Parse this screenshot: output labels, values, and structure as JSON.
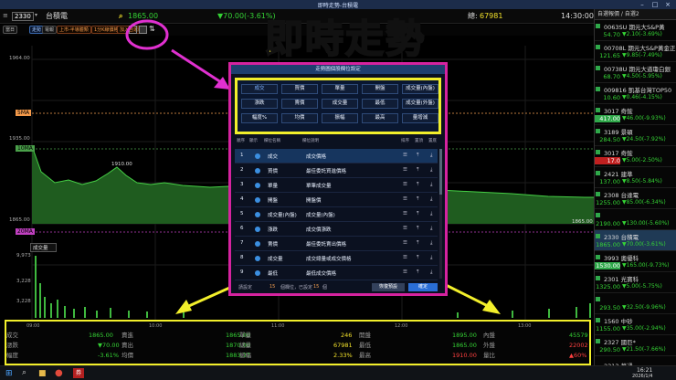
{
  "window": {
    "title": "即時走勢-台積電"
  },
  "header": {
    "code": "2330",
    "name": "台積電",
    "price_partial": "1865.00",
    "change_partial": "▼70.00(-3.61%)",
    "volume_label": "總:",
    "volume": "67981",
    "time": "14:30:00"
  },
  "toolbar": {
    "period": "當日",
    "tab_trend": "走勢",
    "tab_tick": "電報",
    "chips": [
      "上市-半導體類",
      "1分K線價格",
      "加入自選股"
    ]
  },
  "overlay_title": "即時走勢",
  "chart": {
    "y_labels": [
      "1964.00",
      "1935.00",
      "1865.00"
    ],
    "tags": {
      "ma5": "5MA",
      "ma10": "10MA",
      "ma20": "20MA"
    },
    "peak_label": "1910.00",
    "low_label": "1865.00",
    "volume_box": "成交量",
    "vol_labels": [
      "9,973",
      "3,228",
      "3,228"
    ],
    "time_ticks": [
      "09:00",
      "10:00",
      "11:00",
      "12:00",
      "13:00"
    ]
  },
  "bottom_table": [
    {
      "label": "成交",
      "value": "1865.00",
      "label2": "賣進",
      "value2": "1865.00",
      "label3": "單量",
      "value3": "246",
      "label4": "開盤",
      "value4": "1895.00",
      "label5": "內盤",
      "value5": "45579"
    },
    {
      "label": "漲跌",
      "value": "▼70.00",
      "label2": "賣出",
      "value2": "1870.00",
      "label3": "總量",
      "value3": "67981",
      "label4": "最低",
      "value4": "1865.00",
      "label5": "外盤",
      "value5": "22002"
    },
    {
      "label": "幅度",
      "value": "-3.61%",
      "label2": "均價",
      "value2": "1883.37",
      "label3": "振幅",
      "value3": "2.33%",
      "label4": "最高",
      "value4": "1910.00",
      "label5": "量比",
      "value5": "▲60%"
    }
  ],
  "dialog": {
    "title": "走勢圖個股欄位設定",
    "buttons": [
      "成交",
      "買價",
      "單量",
      "開盤",
      "成交量(內盤)",
      "漲跌",
      "賣價",
      "成交量",
      "最低",
      "成交量(外盤)",
      "幅度%",
      "均價",
      "振幅",
      "最高",
      "量增減"
    ],
    "columns": [
      "順序",
      "顯示",
      "欄位名稱",
      "欄位說明",
      "排序",
      "置頂",
      "置底"
    ],
    "rows": [
      {
        "no": "1",
        "field": "成交",
        "desc": "成交價格"
      },
      {
        "no": "2",
        "field": "買價",
        "desc": "最佳委託買進價格"
      },
      {
        "no": "3",
        "field": "單量",
        "desc": "單筆成交量"
      },
      {
        "no": "4",
        "field": "開盤",
        "desc": "開盤價"
      },
      {
        "no": "5",
        "field": "成交量(內盤)",
        "desc": "成交量(內盤)"
      },
      {
        "no": "6",
        "field": "漲跌",
        "desc": "成交價漲跌"
      },
      {
        "no": "7",
        "field": "賣價",
        "desc": "最佳委託賣出價格"
      },
      {
        "no": "8",
        "field": "成交量",
        "desc": "成交總量或成交價格"
      },
      {
        "no": "9",
        "field": "最低",
        "desc": "最低成交價格"
      }
    ],
    "footer_label": "請設定",
    "footer_count": "15",
    "footer_mid": "個欄位，已設定",
    "footer_count2": "15",
    "footer_unit": "個",
    "reset_btn": "恢復預設",
    "ok_btn": "確定"
  },
  "rpanel": {
    "header": "自選報價 / 自選2",
    "items": [
      {
        "name": "0063SU 期元大S&P黃",
        "price": "54.70",
        "change": "▼2.10(-3.69%)"
      },
      {
        "name": "00708L 期元大S&P黃金正",
        "price": "121.65",
        "change": "▼9.85(-7.49%)"
      },
      {
        "name": "00738U 期元大道瓊白銀",
        "price": "68.70",
        "change": "▼4.50(-5.95%)"
      },
      {
        "name": "009816 凱基台灣TOP50",
        "price": "10.60",
        "change": "▼0.46(-4.15%)"
      },
      {
        "name": "3017 奇鋐",
        "price": "417.00",
        "change": "▼46.00(-9.93%)"
      },
      {
        "name": "3189 景碩",
        "price": "284.50",
        "change": "▼24.50(-7.92%)"
      },
      {
        "name": "3017 奇鋐",
        "price": "17.0",
        "change": "▼5.00(-2.50%)"
      },
      {
        "name": "2421 建準",
        "price": "137.00",
        "change": "▼8.50(-5.84%)"
      },
      {
        "name": "2308 台達電",
        "price": "1255.00",
        "change": "▼85.00(-6.34%)"
      },
      {
        "name": "",
        "price": "2190.00",
        "change": "▼130.00(-5.60%)"
      },
      {
        "name": "2330 台積電",
        "price": "1865.00",
        "change": "▼70.00(-3.61%)"
      },
      {
        "name": "3993 奧優科",
        "price": "1530.00",
        "change": "▼165.00(-9.73%)"
      },
      {
        "name": "2301 光寶科",
        "price": "1325.00",
        "change": "▼5.00(-5.75%)"
      },
      {
        "name": "",
        "price": "293.50",
        "change": "▼32.50(-9.96%)"
      },
      {
        "name": "1560 中砂",
        "price": "1155.00",
        "change": "▼35.00(-2.94%)"
      },
      {
        "name": "2327 國巨*",
        "price": "290.50",
        "change": "▼21.50(-7.66%)"
      }
    ],
    "last": "2313 華通"
  },
  "taskbar": {
    "time": "16:21",
    "date": "2026/1/4"
  }
}
